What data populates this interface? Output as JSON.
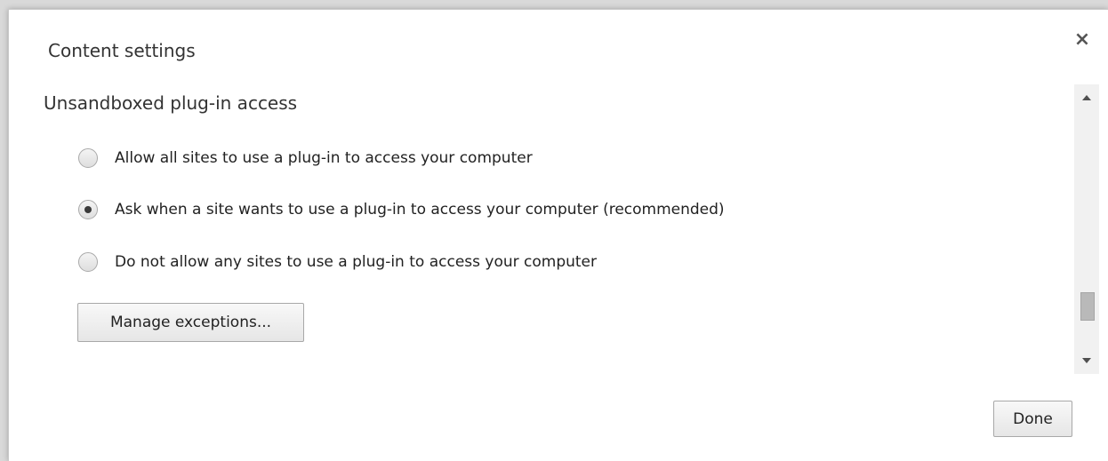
{
  "dialog": {
    "title": "Content settings",
    "close_glyph": "×",
    "close_icon": "close-icon"
  },
  "section": {
    "title": "Unsandboxed plug-in access",
    "options": [
      {
        "label": "Allow all sites to use a plug-in to access your computer",
        "checked": false
      },
      {
        "label": "Ask when a site wants to use a plug-in to access your computer (recommended)",
        "checked": true
      },
      {
        "label": "Do not allow any sites to use a plug-in to access your computer",
        "checked": false
      }
    ],
    "manage_button": "Manage exceptions..."
  },
  "scrollbar": {
    "up_icon": "scroll-up-arrow-icon",
    "down_icon": "scroll-down-arrow-icon"
  },
  "footer": {
    "done_button": "Done"
  }
}
